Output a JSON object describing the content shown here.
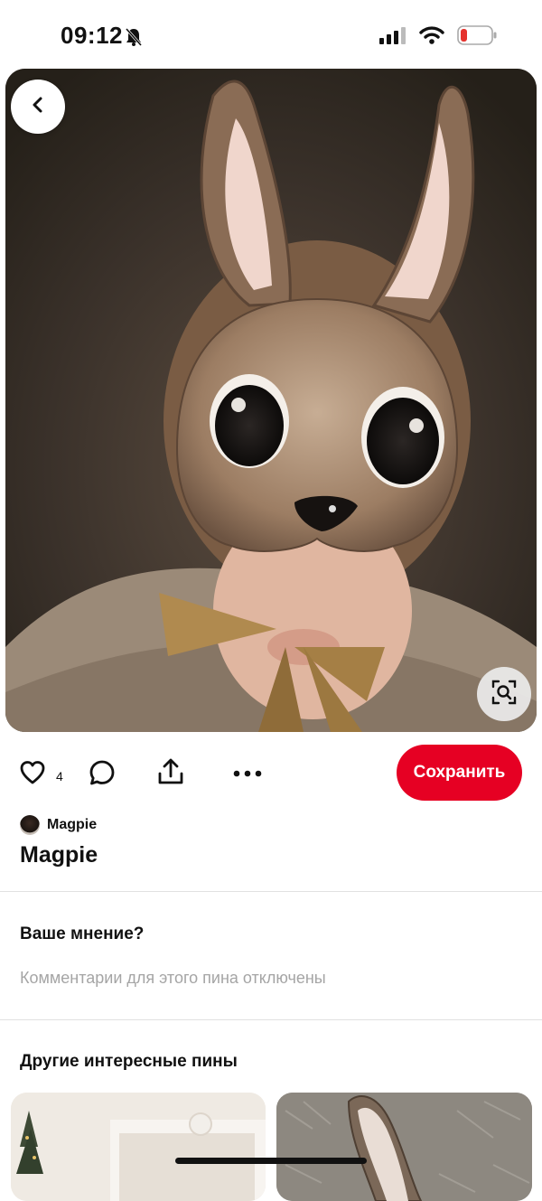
{
  "status_bar": {
    "time": "09:12",
    "icons": [
      "bell-slash-icon",
      "cellular-signal-icon",
      "wifi-icon",
      "battery-low-icon"
    ],
    "battery_color": "#e5322d"
  },
  "hero": {
    "icons": {
      "back": "chevron-left-icon",
      "visual_search": "visual-search-icon"
    }
  },
  "actions": {
    "like_count": "4",
    "icons": [
      "heart-icon",
      "comment-icon",
      "share-icon",
      "more-icon"
    ],
    "save_label": "Сохранить",
    "save_color": "#e60023"
  },
  "pin": {
    "author_name": "Magpie",
    "title": "Magpie"
  },
  "comments": {
    "heading": "Ваше мнение?",
    "disabled_text": "Комментарии для этого пина отключены"
  },
  "more_pins": {
    "heading": "Другие интересные пины"
  }
}
